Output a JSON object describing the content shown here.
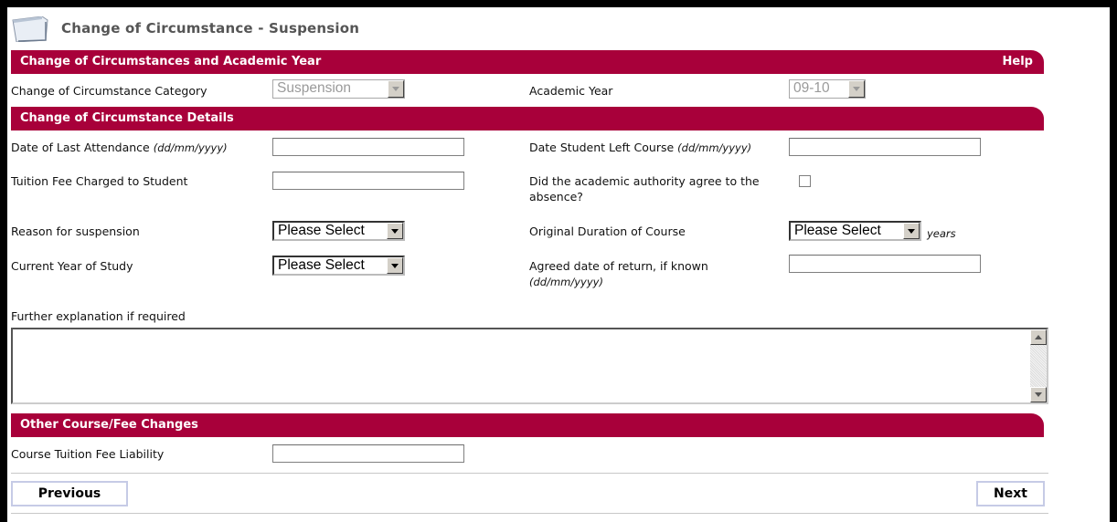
{
  "page": {
    "title": "Change of Circumstance - Suspension"
  },
  "sections": {
    "academic": {
      "title": "Change of Circumstances and Academic Year",
      "help": "Help"
    },
    "details": {
      "title": "Change of Circumstance Details"
    },
    "other": {
      "title": "Other Course/Fee Changes"
    }
  },
  "fields": {
    "category": {
      "label": "Change of Circumstance Category",
      "value": "Suspension"
    },
    "academic_year": {
      "label": "Academic Year",
      "value": "09-10"
    },
    "last_attendance": {
      "label": "Date of Last Attendance",
      "hint": "(dd/mm/yyyy)",
      "value": ""
    },
    "date_left": {
      "label": "Date Student Left Course",
      "hint": "(dd/mm/yyyy)",
      "value": ""
    },
    "tuition_fee": {
      "label": "Tuition Fee Charged to Student",
      "value": ""
    },
    "authority_agree": {
      "label": "Did the academic authority agree to the absence?",
      "checked": false
    },
    "reason": {
      "label": "Reason for suspension",
      "value": "Please Select"
    },
    "original_duration": {
      "label": "Original Duration of Course",
      "value": "Please Select",
      "suffix": "years"
    },
    "current_year": {
      "label": "Current Year of Study",
      "value": "Please Select"
    },
    "return_date": {
      "label": "Agreed date of return, if known",
      "hint": "(dd/mm/yyyy)",
      "value": ""
    },
    "explanation": {
      "label": "Further explanation if required",
      "value": ""
    },
    "fee_liability": {
      "label": "Course Tuition Fee Liability",
      "value": ""
    }
  },
  "buttons": {
    "previous": "Previous",
    "next": "Next"
  },
  "colors": {
    "section_bar": "#a8003a",
    "button_border": "#c6cbe6"
  }
}
